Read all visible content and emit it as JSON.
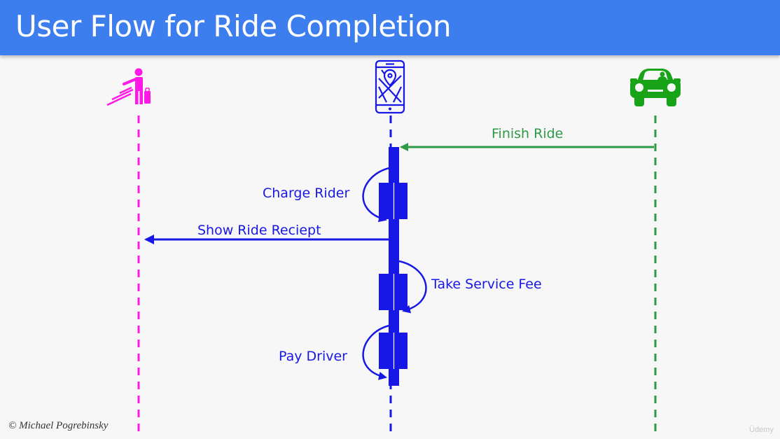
{
  "header": {
    "title": "User Flow for Ride Completion"
  },
  "actors": [
    {
      "name": "rider",
      "icon": "rider-hailing-icon",
      "color": "#ff18e6"
    },
    {
      "name": "app",
      "icon": "phone-map-icon",
      "color": "#1818e6"
    },
    {
      "name": "driver",
      "icon": "car-driver-icon",
      "color": "#1a9a1a"
    }
  ],
  "messages": {
    "finish_ride": "Finish Ride",
    "charge_rider": "Charge Rider",
    "show_receipt": "Show Ride Reciept",
    "take_service_fee": "Take Service Fee",
    "pay_driver": "Pay Driver"
  },
  "colors": {
    "header": "#3d7eef",
    "rider": "#ff18e6",
    "app": "#1818e6",
    "driver_lifeline": "#2e9a45",
    "driver_icon": "#19a319"
  },
  "footer": {
    "credit": "© Michael Pogrebinsky",
    "watermark": "Ūdemy"
  }
}
